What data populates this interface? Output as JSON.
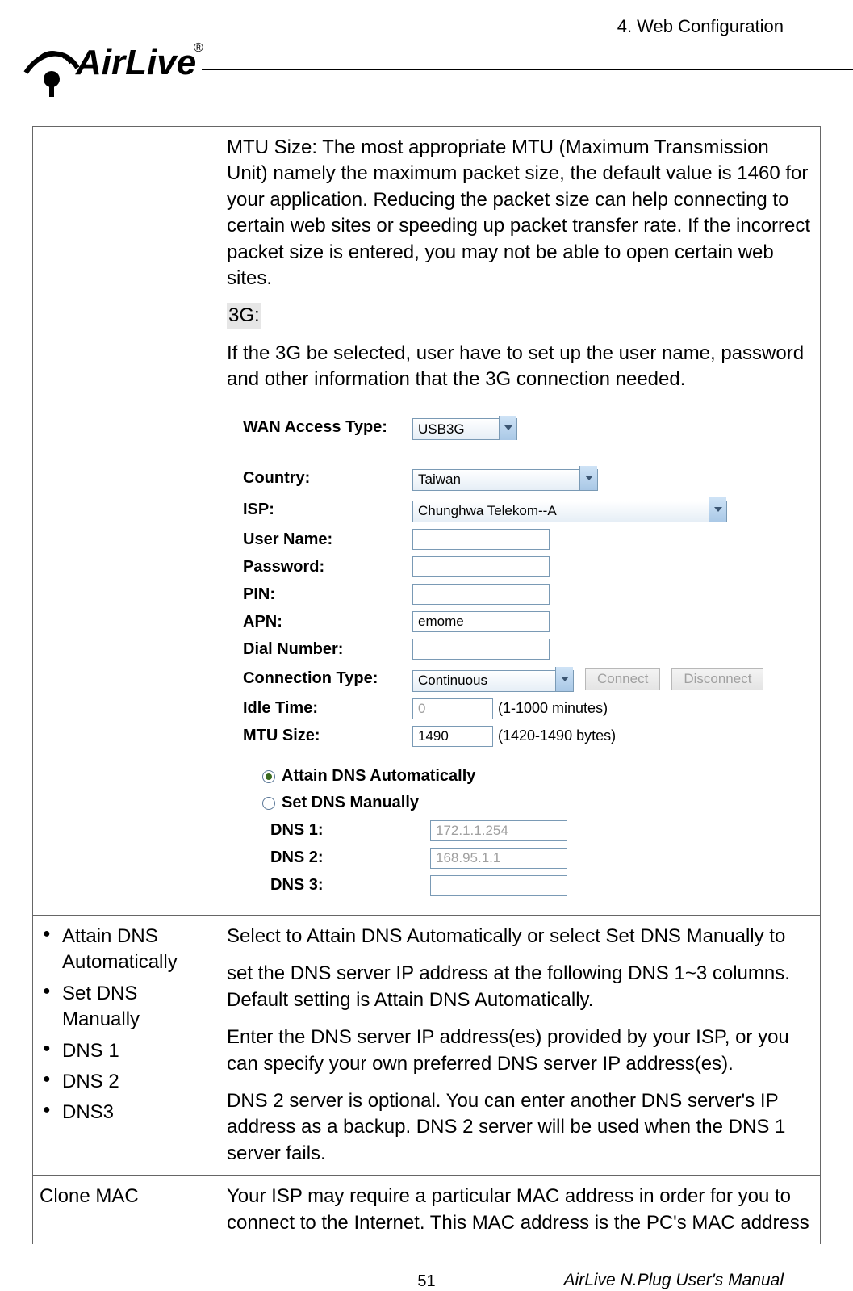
{
  "header": {
    "chapter": "4. Web Configuration"
  },
  "logo": {
    "brand_top": "Air",
    "brand_bottom": "Live",
    "reg": "®"
  },
  "row1": {
    "mtu_para": "MTU Size: The most appropriate MTU (Maximum Transmission Unit) namely the maximum packet size, the default value is 1460 for your application. Reducing the packet size can help connecting to certain web sites or speeding up packet transfer rate. If the incorrect packet size is entered, you may not be able to open certain web sites.",
    "g3_label": "3G:",
    "g3_para": "If the 3G be selected, user have to set up the user name, password and other information that the 3G connection needed."
  },
  "form": {
    "wan_label": "WAN Access Type:",
    "wan_value": "USB3G",
    "country_label": "Country:",
    "country_value": "Taiwan",
    "isp_label": "ISP:",
    "isp_value": "Chunghwa Telekom--A",
    "user_label": "User Name:",
    "user_value": "",
    "pass_label": "Password:",
    "pass_value": "",
    "pin_label": "PIN:",
    "pin_value": "",
    "apn_label": "APN:",
    "apn_value": "emome",
    "dial_label": "Dial Number:",
    "dial_value": "",
    "ct_label": "Connection Type:",
    "ct_value": "Continuous",
    "btn_connect": "Connect",
    "btn_disconnect": "Disconnect",
    "idle_label": "Idle Time:",
    "idle_value": "0",
    "idle_note": "(1-1000 minutes)",
    "mtu_label": "MTU Size:",
    "mtu_value": "1490",
    "mtu_note": "(1420-1490 bytes)",
    "radio_auto": "Attain DNS Automatically",
    "radio_manual": "Set DNS Manually",
    "dns1_label": "DNS 1:",
    "dns1_value": "172.1.1.254",
    "dns2_label": "DNS 2:",
    "dns2_value": "168.95.1.1",
    "dns3_label": "DNS 3:",
    "dns3_value": ""
  },
  "row2": {
    "bullets": [
      "Attain DNS Automatically",
      "Set DNS Manually",
      "DNS 1",
      "DNS 2",
      "DNS3"
    ],
    "p1": "Select to Attain DNS Automatically or select Set DNS Manually to",
    "p2": "set the DNS server IP address at the following DNS    1~3 columns. Default setting is Attain DNS Automatically.",
    "p3": "Enter the DNS server IP address(es) provided by your ISP, or you can specify your own preferred DNS server IP address(es).",
    "p4": "DNS 2 server is optional. You can enter another DNS server's IP address as a backup. DNS 2 server will be used when the DNS 1 server fails."
  },
  "row3": {
    "left": "Clone MAC",
    "right": "Your ISP may require a particular MAC address in order for you to connect to the Internet. This MAC address is the PC's MAC address"
  },
  "footer": {
    "page": "51",
    "title": "AirLive N.Plug User's Manual"
  }
}
